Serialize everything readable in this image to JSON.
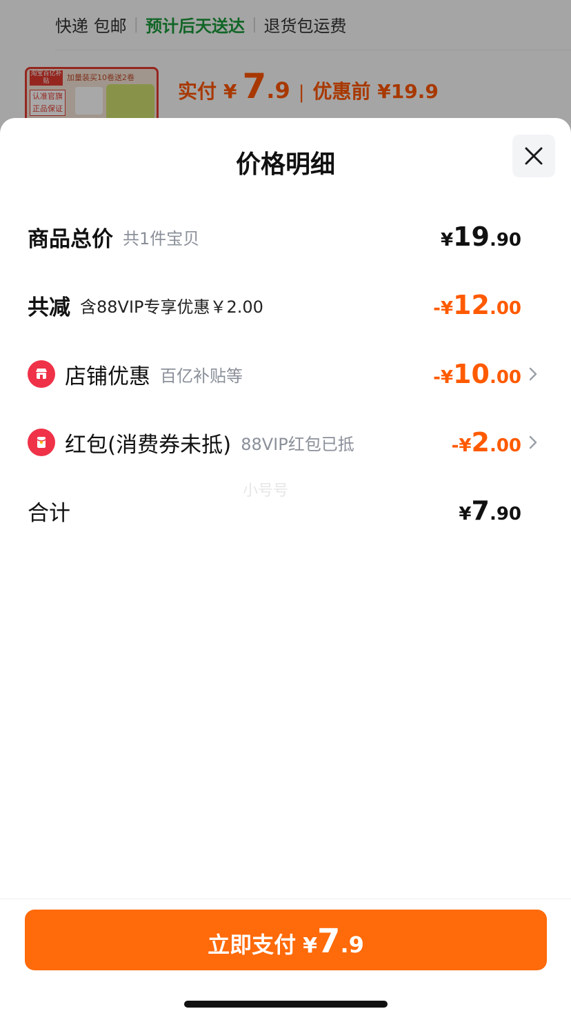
{
  "background": {
    "shipping": {
      "express": "快递 包邮",
      "delivery": "预计后天送达",
      "returns": "退货包运费"
    },
    "thumb": {
      "tag_brand": "淘宝百亿补贴",
      "tag_promo": "加量装买10卷送2卷",
      "tag_official": "认准官旗正品保证"
    },
    "price": {
      "paid_label": "实付",
      "currency": "¥",
      "paid_int": "7",
      "paid_dec": ".9",
      "before_label": "优惠前 ¥19.9"
    }
  },
  "sheet": {
    "title": "价格明细",
    "close_icon": "close-icon",
    "rows": [
      {
        "label": "商品总价",
        "sub": "共1件宝贝",
        "currency": "¥",
        "int": "19",
        "dec": ".90"
      },
      {
        "label": "共减",
        "sub": "含88VIP专享优惠￥2.00",
        "currency": "-¥",
        "int": "12",
        "dec": ".00"
      },
      {
        "label": "店铺优惠",
        "sub": "百亿补贴等",
        "currency": "-¥",
        "int": "10",
        "dec": ".00",
        "icon": "store-icon"
      },
      {
        "label": "红包(消费券未抵)",
        "sub": "88VIP红包已抵",
        "currency": "-¥",
        "int": "2",
        "dec": ".00",
        "icon": "red-packet-icon"
      },
      {
        "label": "合计",
        "currency": "¥",
        "int": "7",
        "dec": ".90"
      }
    ],
    "watermark": "小号号",
    "pay_button": {
      "label": "立即支付",
      "currency": "¥",
      "int": "7",
      "dec": ".9"
    }
  },
  "colors": {
    "accent": "#ff6a0a",
    "discount": "#ff5a00",
    "delivery_green": "#1a9a3a",
    "icon_red": "#ef3248"
  }
}
